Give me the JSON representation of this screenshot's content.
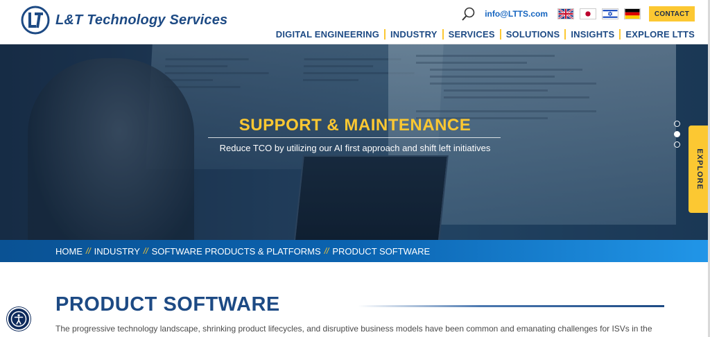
{
  "brand": {
    "name": "L&T Technology Services",
    "color": "#1d4a84",
    "accent": "#fcc832"
  },
  "utility": {
    "email": "info@LTTS.com",
    "contact_label": "CONTACT",
    "flags": [
      "uk-flag-icon",
      "japan-flag-icon",
      "israel-flag-icon",
      "germany-flag-icon"
    ]
  },
  "nav": {
    "items": [
      "DIGITAL ENGINEERING",
      "INDUSTRY",
      "SERVICES",
      "SOLUTIONS",
      "INSIGHTS",
      "EXPLORE LTTS"
    ]
  },
  "hero": {
    "title": "SUPPORT & MAINTENANCE",
    "subtitle": "Reduce TCO by utilizing our AI first approach and shift left initiatives",
    "slides": 3,
    "active_slide": 2,
    "explore_label": "EXPLORE"
  },
  "breadcrumb": {
    "items": [
      "HOME",
      "INDUSTRY",
      "SOFTWARE PRODUCTS & PLATFORMS",
      "PRODUCT SOFTWARE"
    ],
    "separator": "//"
  },
  "content": {
    "title": "PRODUCT SOFTWARE",
    "intro": "The progressive technology landscape, shrinking product lifecycles, and disruptive business models have been common and emanating challenges for ISVs in the"
  }
}
